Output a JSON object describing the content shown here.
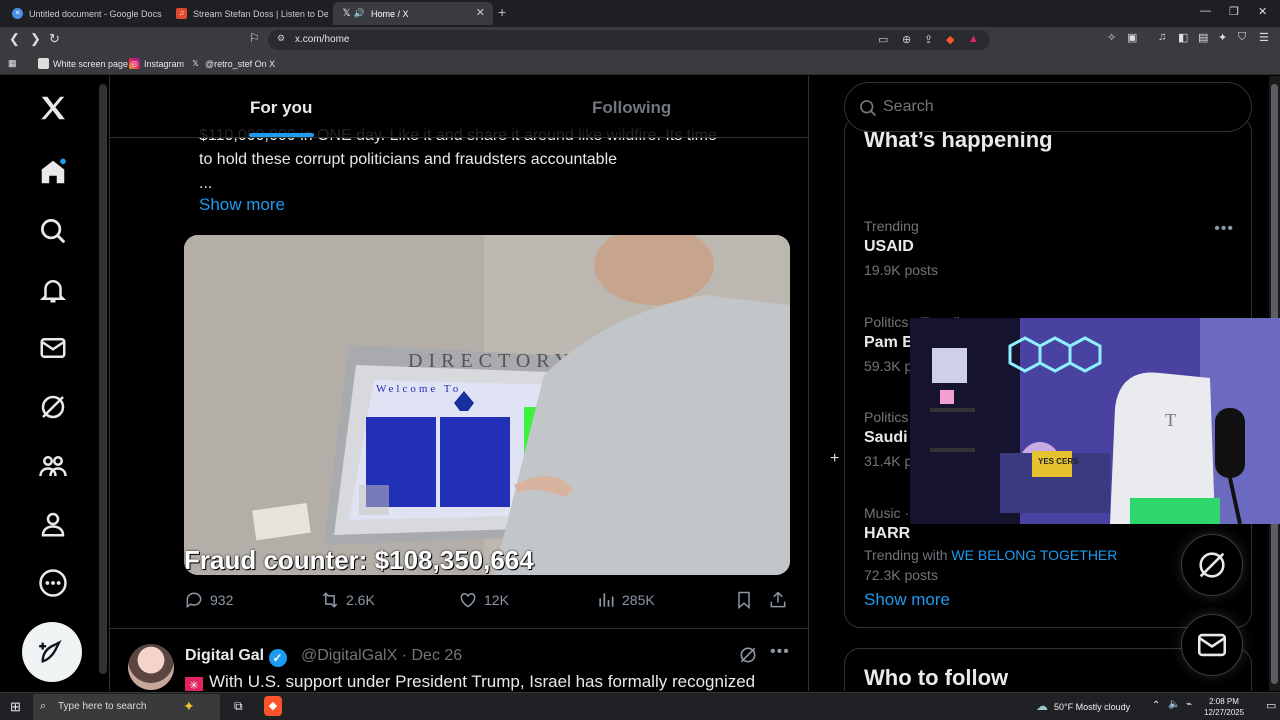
{
  "browser": {
    "tabs": [
      {
        "label": "Untitled document - Google Docs",
        "active": false
      },
      {
        "label": "Stream Stefan Doss | Listen to Decen",
        "active": false
      },
      {
        "label": "Home / X",
        "active": true
      }
    ],
    "url": "x.com/home",
    "bookmarks": [
      "White screen page",
      "Instagram",
      "@retro_stef On X"
    ]
  },
  "feed": {
    "tabs": {
      "for_you": "For you",
      "following": "Following"
    },
    "post": {
      "text_line1": "$110,000,000 in ONE day. Like it and share it around like wildfire. Its time",
      "text_line2": "to hold these corrupt politicians and fraudsters accountable",
      "ellipsis": "...",
      "show_more": "Show more",
      "media_caption": "Fraud counter: $108,350,664",
      "directory_sign": "DIRECTORY",
      "screen_welcome": "Welcome To",
      "stats": {
        "replies": "932",
        "reposts": "2.6K",
        "likes": "12K",
        "views": "285K"
      }
    },
    "next_post": {
      "name": "Digital Gal",
      "handle": "@DigitalGalX · Dec 26",
      "text": "With U.S. support under President Trump, Israel has formally recognized"
    }
  },
  "sidebar": {
    "search_placeholder": "Search",
    "trends_title": "What’s happening",
    "trends": [
      {
        "context": "Trending",
        "name": "USAID",
        "count": "19.9K posts"
      },
      {
        "context": "Politics · Trending",
        "name": "Pam Bondi",
        "count": "59.3K posts"
      },
      {
        "context": "Politics",
        "name": "Saudi",
        "count": "31.4K posts"
      },
      {
        "context": "Music ·",
        "name": "HARR",
        "count": "72.3K posts",
        "extra": "Trending with",
        "extra_link": "WE BELONG TOGETHER"
      }
    ],
    "show_more": "Show more",
    "who_to_follow": "Who to follow"
  },
  "webcam": {
    "pillow_text": "YES CERS"
  },
  "taskbar": {
    "search_placeholder": "Type here to search",
    "weather": "50°F  Mostly cloudy",
    "time": "2:08 PM",
    "date": "12/27/2025"
  },
  "colors": {
    "accent": "#1d9bf0",
    "background": "#000000",
    "border": "#2f3336",
    "muted": "#71767b"
  }
}
